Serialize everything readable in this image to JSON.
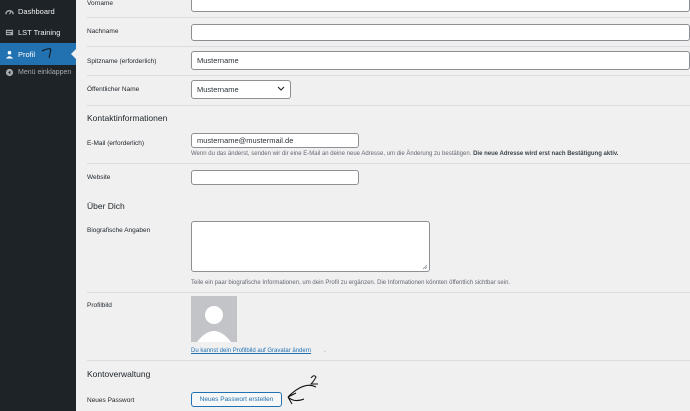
{
  "sidebar": {
    "items": [
      {
        "label": "Dashboard",
        "icon": "dashboard-icon"
      },
      {
        "label": "LST Training",
        "icon": "document-icon"
      },
      {
        "label": "Profil",
        "icon": "user-icon",
        "active": true
      },
      {
        "label": "Menü einklappen",
        "icon": "collapse-icon"
      }
    ]
  },
  "annotations": {
    "mark_1": "1",
    "mark_2": "2"
  },
  "form": {
    "vorname_label": "Vorname",
    "nachname_label": "Nachname",
    "spitzname_label": "Spitzname (erforderlich)",
    "spitzname_value": "Mustername",
    "public_name_label": "Öffentlicher Name",
    "public_name_value": "Mustername",
    "contact_heading": "Kontaktinformationen",
    "email_label": "E-Mail (erforderlich)",
    "email_value": "mustername@mustermail.de",
    "email_desc": "Wenn du das änderst, senden wir dir eine E-Mail an deine neue Adresse, um die Änderung zu bestätigen.",
    "email_desc_bold": "Die neue Adresse wird erst nach Bestätigung aktiv.",
    "website_label": "Website",
    "about_heading": "Über Dich",
    "bio_label": "Biografische Angaben",
    "bio_desc": "Teile ein paar biografische Informationen, um dein Profil zu ergänzen. Die Informationen könnten öffentlich sichtbar sein.",
    "avatar_label": "Profilbild",
    "avatar_link": "Du kannst dein Profilbild auf Gravatar ändern",
    "avatar_link_suffix": ".",
    "account_heading": "Kontoverwaltung",
    "password_label": "Neues Passwort",
    "password_button": "Neues Passwort erstellen"
  },
  "colors": {
    "sidebar_bg": "#1d2327",
    "accent": "#2271b1",
    "page_bg": "#f0f0f1"
  }
}
